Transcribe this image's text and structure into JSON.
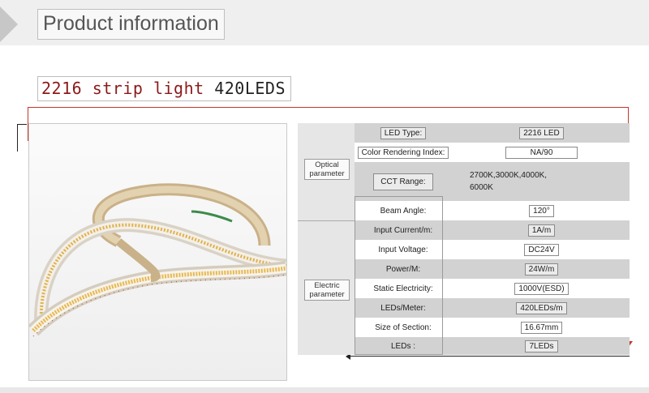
{
  "header": {
    "title": "Product information"
  },
  "product": {
    "name": "2216 strip light",
    "led_count": "420LEDS"
  },
  "groups": [
    {
      "label": "Optical parameter"
    },
    {
      "label": "Electric parameter"
    }
  ],
  "specs": [
    {
      "param": "LED Type:",
      "value": "2216 LED"
    },
    {
      "param": "Color Rendering Index:",
      "value": "NA/90"
    },
    {
      "param": "CCT Range:",
      "value": "2700K,3000K,4000K, 6000K"
    },
    {
      "param": "Beam Angle:",
      "value": "120°"
    },
    {
      "param": "Input Current/m:",
      "value": "1A/m"
    },
    {
      "param": "Input Voltage:",
      "value": "DC24V"
    },
    {
      "param": "Power/M:",
      "value": "24W/m"
    },
    {
      "param": "Static Electricity:",
      "value": "1000V(ESD)"
    },
    {
      "param": "LEDs/Meter:",
      "value": "420LEDs/m"
    },
    {
      "param": "Size of Section:",
      "value": "16.67mm"
    },
    {
      "param": "LEDs :",
      "value": "7LEDs"
    }
  ],
  "colors": {
    "accent_red": "#c0392b",
    "title_red": "#8b1a1a",
    "row_gray": "#d2d2d2"
  }
}
